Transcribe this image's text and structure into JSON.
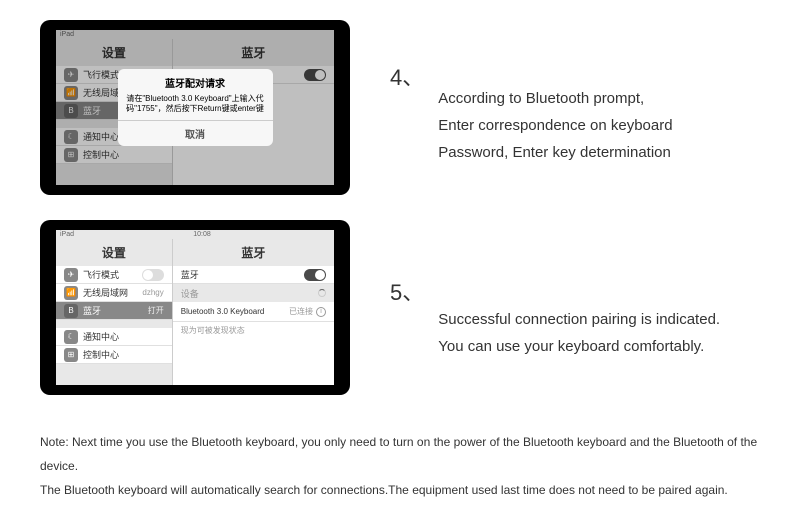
{
  "step4": {
    "num": "4、",
    "line1": "According to Bluetooth prompt,",
    "line2": "Enter correspondence on keyboard",
    "line3": "Password, Enter key determination",
    "tablet": {
      "status_left": "iPad",
      "left_header": "设置",
      "right_header": "蓝牙",
      "left_items": [
        {
          "icon": "✈",
          "label": "飞行模式",
          "val": ""
        },
        {
          "icon": "📶",
          "label": "无线局域网",
          "val": ""
        },
        {
          "icon": "B",
          "label": "蓝牙",
          "val": "",
          "sel": true
        },
        {
          "icon": "☾",
          "label": "通知中心",
          "val": ""
        },
        {
          "icon": "⊞",
          "label": "控制中心",
          "val": ""
        }
      ],
      "right_bt_label": "蓝牙",
      "modal": {
        "title": "蓝牙配对请求",
        "body": "请在\"Bluetooth 3.0 Keyboard\"上输入代码\"1755\"，然后按下Return键或enter键",
        "cancel": "取消"
      }
    }
  },
  "step5": {
    "num": "5、",
    "line1": "Successful connection pairing is indicated.",
    "line2": "You can use your keyboard comfortably.",
    "tablet": {
      "status_left": "iPad",
      "status_time": "10:08",
      "left_header": "设置",
      "right_header": "蓝牙",
      "left_items": [
        {
          "icon": "✈",
          "label": "飞行模式",
          "val": ""
        },
        {
          "icon": "📶",
          "label": "无线局域网",
          "val": "dzhgy"
        },
        {
          "icon": "B",
          "label": "蓝牙",
          "val": "打开",
          "sel": true
        },
        {
          "icon": "☾",
          "label": "通知中心",
          "val": ""
        },
        {
          "icon": "⊞",
          "label": "控制中心",
          "val": ""
        }
      ],
      "right_bt_label": "蓝牙",
      "right_devices_label": "设备",
      "device_name": "Bluetooth 3.0 Keyboard",
      "device_status": "已连接",
      "discoverable": "现为可被发现状态"
    }
  },
  "note": {
    "line1": "Note: Next time you use the Bluetooth keyboard, you only need to turn on the power of the Bluetooth keyboard and the Bluetooth of the device.",
    "line2": "The Bluetooth keyboard will automatically search for connections.The equipment used last time does not need to be paired again."
  }
}
